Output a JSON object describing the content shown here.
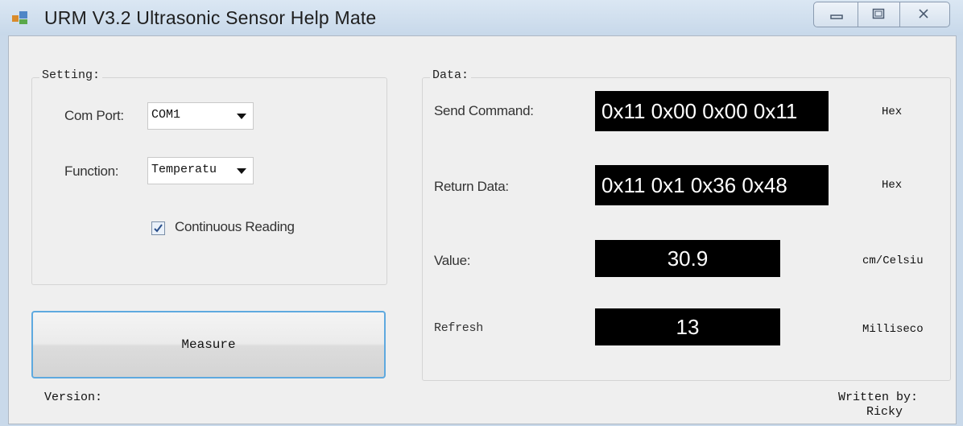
{
  "window": {
    "title": "URM V3.2 Ultrasonic Sensor Help Mate",
    "icons": [
      "app-icon",
      "minimize-icon",
      "maximize-icon",
      "close-icon"
    ]
  },
  "setting": {
    "legend": "Setting:",
    "com_port_label": "Com Port:",
    "com_port_value": "COM1",
    "function_label": "Function:",
    "function_value": "Temperatu",
    "continuous_label": "Continuous Reading",
    "continuous_checked": true
  },
  "measure_button": "Measure",
  "data": {
    "legend": "Data:",
    "send_label": "Send Command:",
    "send_value": "0x11 0x00 0x00 0x11",
    "send_unit": "Hex",
    "return_label": "Return Data:",
    "return_value": "0x11 0x1 0x36 0x48",
    "return_unit": "Hex",
    "value_label": "Value:",
    "value_value": "30.9",
    "value_unit": "cm/Celsiu",
    "refresh_label": "Refresh",
    "refresh_value": "13",
    "refresh_unit": "Milliseco"
  },
  "footer": {
    "version_label": "Version:",
    "written_by_line1": "Written by:",
    "written_by_line2": "Ricky"
  }
}
